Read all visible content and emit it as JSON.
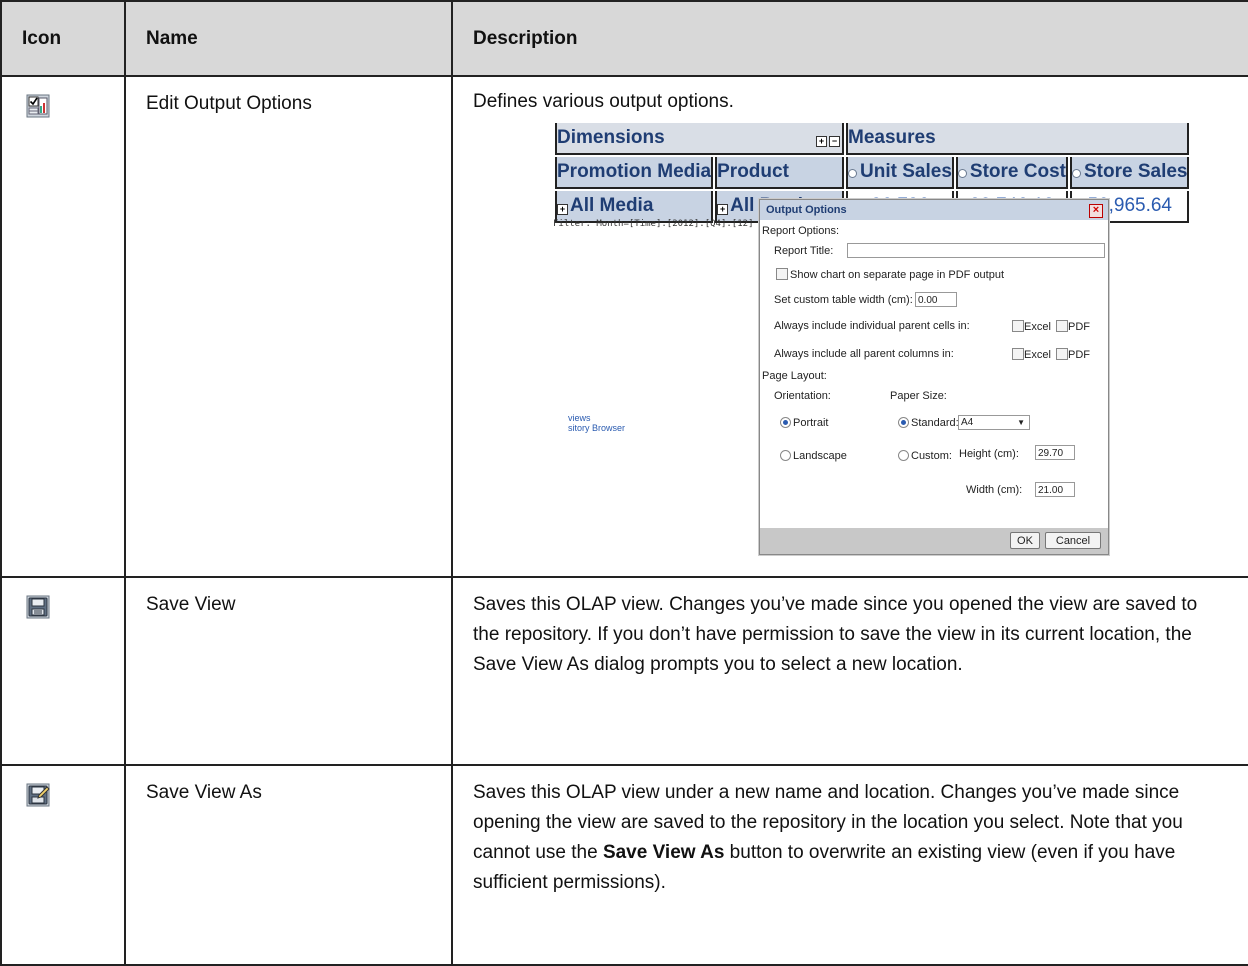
{
  "headers": {
    "icon": "Icon",
    "name": "Name",
    "description": "Description"
  },
  "rows": [
    {
      "icon": "edit-output-options-icon",
      "name": "Edit Output Options",
      "description": "Defines various output options."
    },
    {
      "icon": "save-view-icon",
      "name": "Save View",
      "description": "Saves this OLAP view. Changes you’ve made since you opened the view are saved to the repository. If you don’t have permission to save the view in its current location, the Save View As dialog prompts you to select a new location."
    },
    {
      "icon": "save-view-as-icon",
      "name": "Save View As",
      "description_before": "Saves this OLAP view under a new name and location. Changes you’ve made since opening the view are saved to the repository in the location you select. Note that you cannot use the ",
      "description_bold": "Save View As",
      "description_after": " button to overwrite an existing view (even if you have sufficient permissions)."
    }
  ],
  "screenshot": {
    "grid": {
      "dimensions": "Dimensions",
      "measures": "Measures",
      "col_promotion": "Promotion Media",
      "col_product": "Product",
      "m_unit_sales": "Unit Sales",
      "m_store_cost": "Store Cost",
      "m_store_sales": "Store Sales",
      "all_media": "All Media",
      "all_products": "All Products",
      "v_unit_sales": "26,796",
      "v_store_cost": "22,746.13",
      "v_store_sales": "56,965.64"
    },
    "filter": "Filter: Month=[Time].[2012].[Q4].[12]",
    "side_links": [
      "views",
      "sitory Browser"
    ],
    "dialog": {
      "title": "Output Options",
      "report_options": "Report Options:",
      "report_title_label": "Report Title:",
      "report_title_value": "",
      "show_chart": "Show chart on separate page in PDF output",
      "custom_width_label": "Set custom table width (cm):",
      "custom_width_value": "0.00",
      "parent_cells": "Always include individual parent cells in:",
      "parent_columns": "Always include all parent columns in:",
      "excel": "Excel",
      "pdf": "PDF",
      "page_layout": "Page Layout:",
      "orientation": "Orientation:",
      "paper_size": "Paper Size:",
      "portrait": "Portrait",
      "landscape": "Landscape",
      "standard": "Standard:",
      "standard_value": "A4",
      "custom": "Custom:",
      "height_label": "Height (cm):",
      "height_value": "29.70",
      "width_label": "Width (cm):",
      "width_value": "21.00",
      "ok": "OK",
      "cancel": "Cancel"
    }
  }
}
